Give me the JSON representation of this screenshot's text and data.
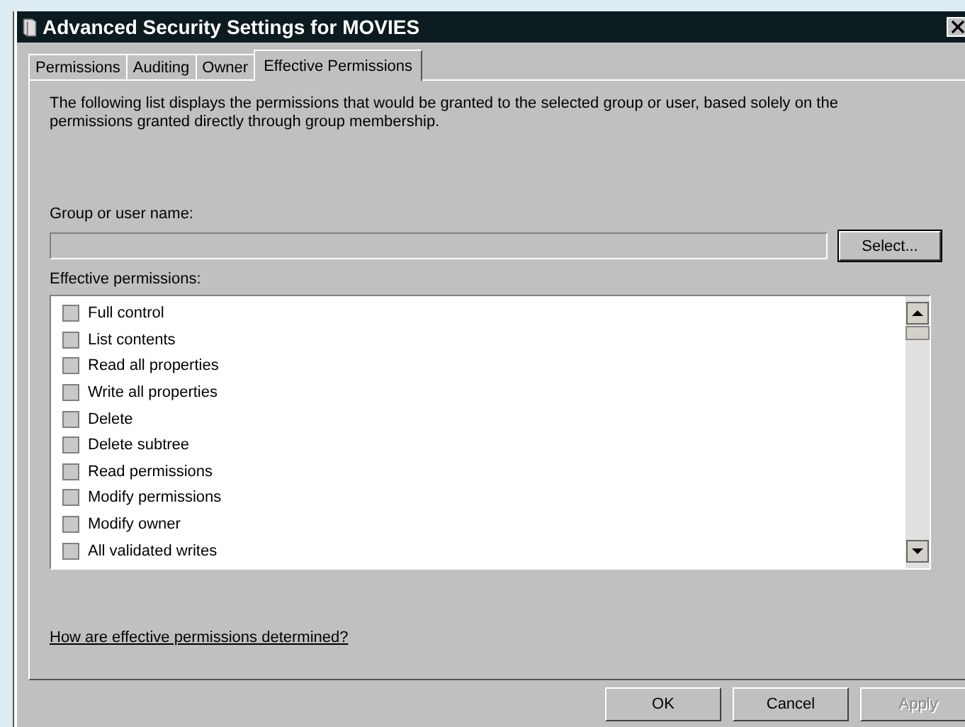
{
  "window": {
    "title": "Advanced Security Settings for MOVIES"
  },
  "tabs": [
    {
      "label": "Permissions",
      "selected": false
    },
    {
      "label": "Auditing",
      "selected": false
    },
    {
      "label": "Owner",
      "selected": false
    },
    {
      "label": "Effective Permissions",
      "selected": true
    }
  ],
  "description": "The following list displays the permissions that would be granted to the selected group or user, based solely on the permissions granted directly through group membership.",
  "group_field": {
    "label": "Group or user name:",
    "disabled": true
  },
  "select_button": "Select...",
  "permissions_label": "Effective permissions:",
  "permissions": [
    {
      "label": "Full control",
      "checked": false
    },
    {
      "label": "List contents",
      "checked": false
    },
    {
      "label": "Read all properties",
      "checked": false
    },
    {
      "label": "Write all properties",
      "checked": false
    },
    {
      "label": "Delete",
      "checked": false
    },
    {
      "label": "Delete subtree",
      "checked": false
    },
    {
      "label": "Read permissions",
      "checked": false
    },
    {
      "label": "Modify permissions",
      "checked": false
    },
    {
      "label": "Modify owner",
      "checked": false
    },
    {
      "label": "All validated writes",
      "checked": false
    }
  ],
  "help_link": "How are effective permissions determined?",
  "buttons": [
    {
      "label": "OK",
      "disabled": false
    },
    {
      "label": "Cancel",
      "disabled": false
    },
    {
      "label": "Apply",
      "disabled": true
    }
  ]
}
